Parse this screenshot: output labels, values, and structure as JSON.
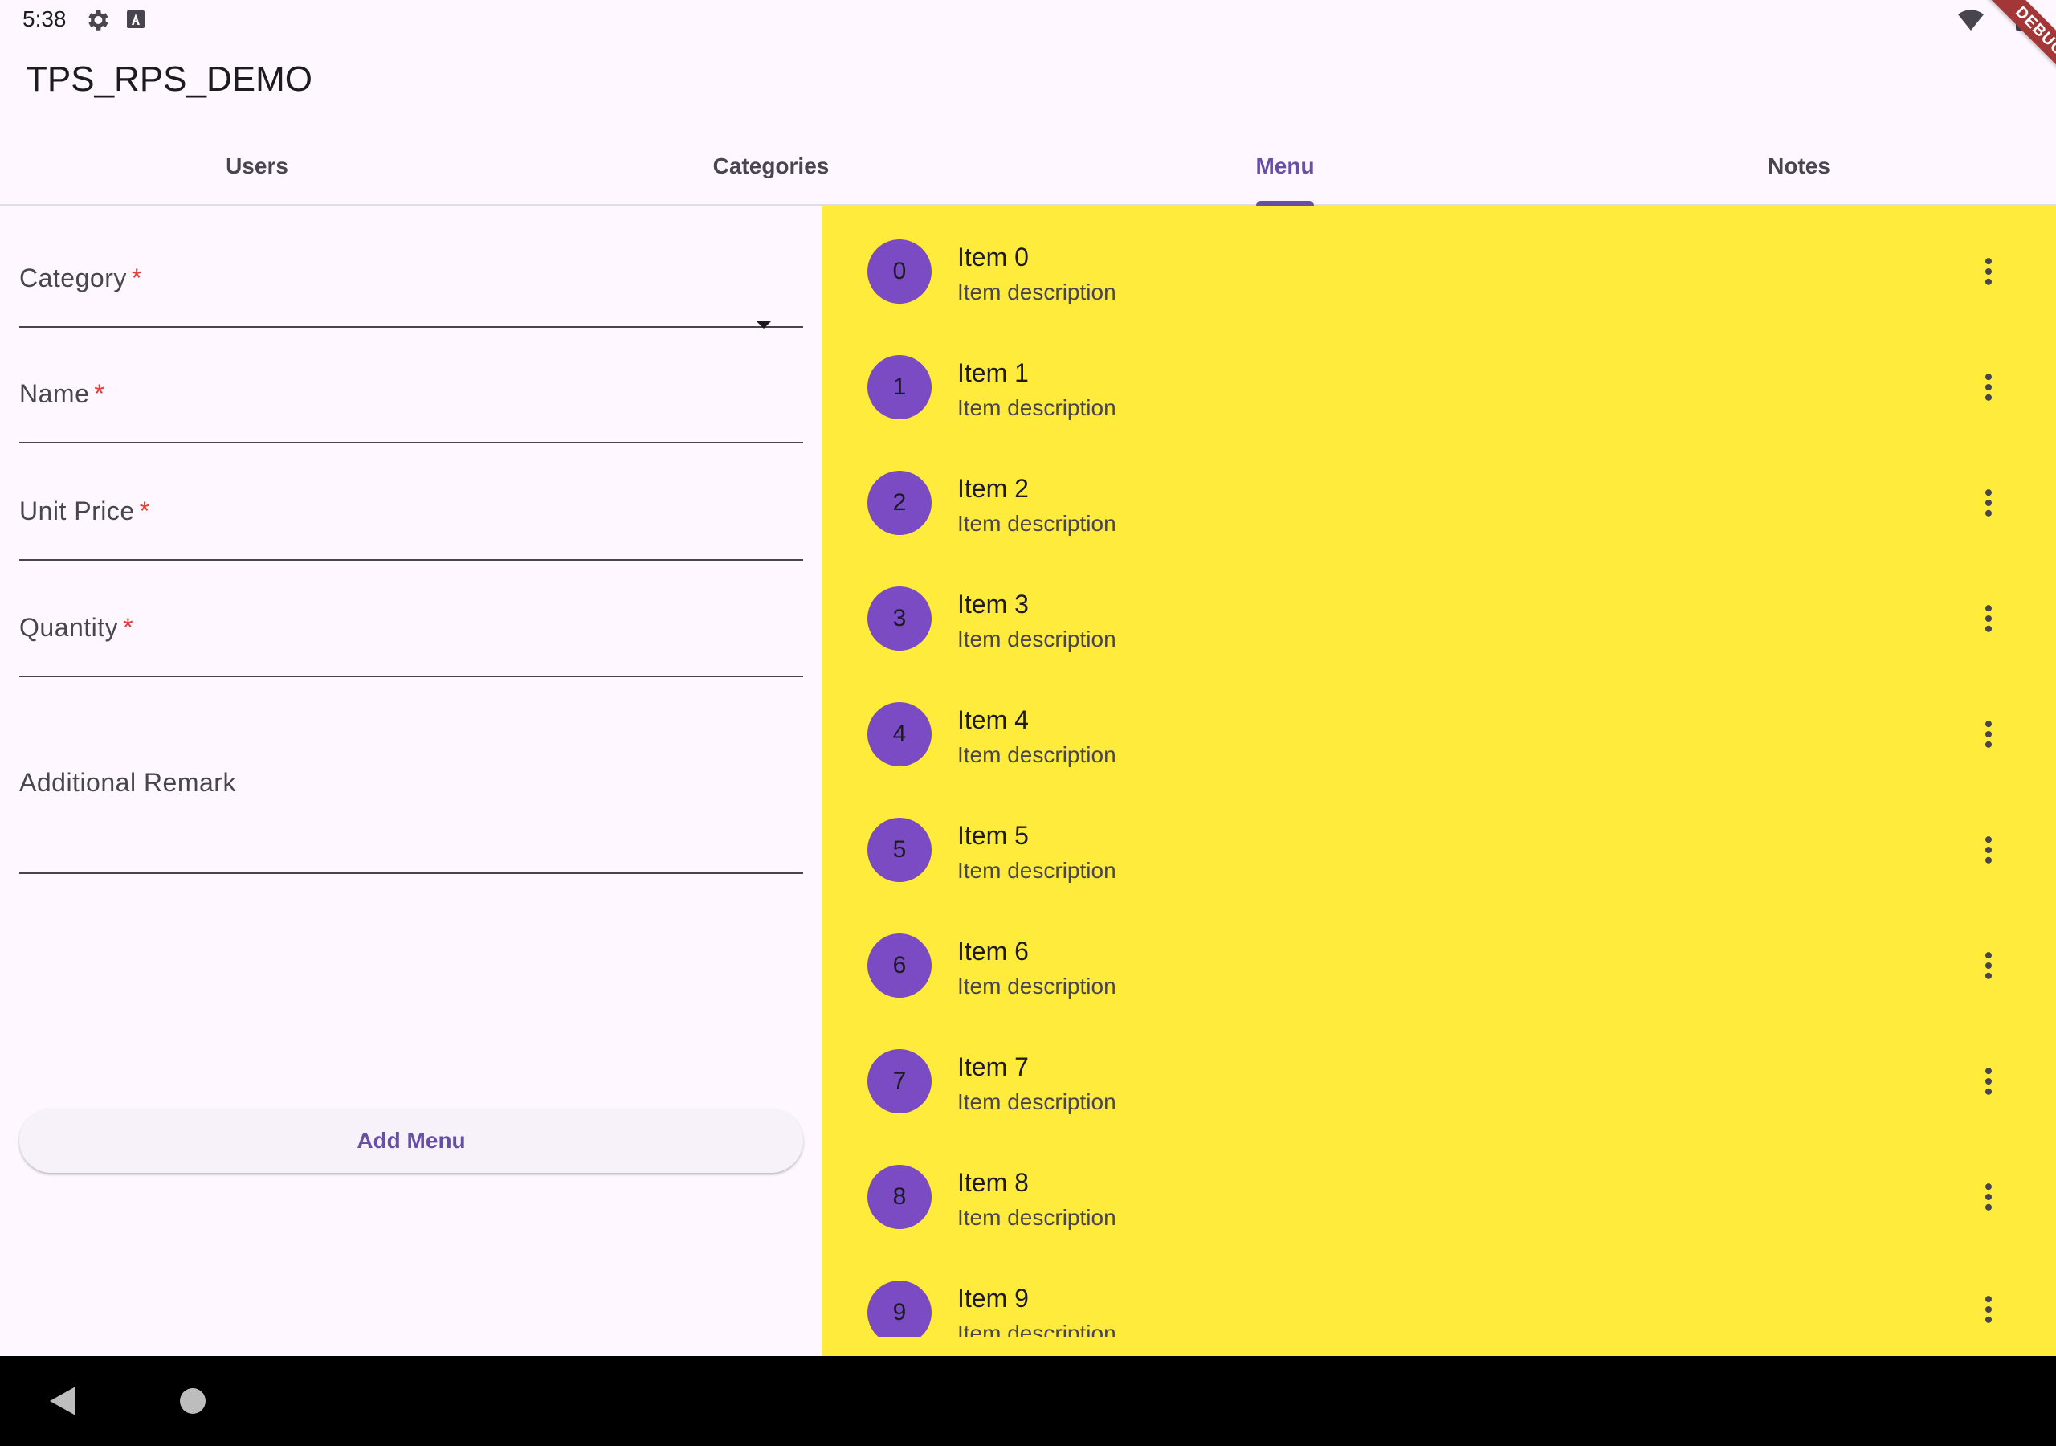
{
  "status_bar": {
    "time": "5:38",
    "icons": [
      "gear-icon",
      "a-icon",
      "wifi-icon",
      "battery-icon"
    ]
  },
  "debug_banner": "DEBUG",
  "app_bar": {
    "title": "TPS_RPS_DEMO"
  },
  "tabs": [
    {
      "label": "Users",
      "active": false
    },
    {
      "label": "Categories",
      "active": false
    },
    {
      "label": "Menu",
      "active": true
    },
    {
      "label": "Notes",
      "active": false
    }
  ],
  "form": {
    "category": {
      "label": "Category",
      "required_mark": "*",
      "value": ""
    },
    "name": {
      "label": "Name",
      "required_mark": "*",
      "value": ""
    },
    "unit_price": {
      "label": "Unit Price",
      "required_mark": "*",
      "value": ""
    },
    "quantity": {
      "label": "Quantity",
      "required_mark": "*",
      "value": ""
    },
    "remark": {
      "label": "Additional Remark",
      "value": ""
    },
    "submit_label": "Add Menu"
  },
  "menu_list": {
    "items": [
      {
        "index": "0",
        "title": "Item 0",
        "description": "Item description"
      },
      {
        "index": "1",
        "title": "Item 1",
        "description": "Item description"
      },
      {
        "index": "2",
        "title": "Item 2",
        "description": "Item description"
      },
      {
        "index": "3",
        "title": "Item 3",
        "description": "Item description"
      },
      {
        "index": "4",
        "title": "Item 4",
        "description": "Item description"
      },
      {
        "index": "5",
        "title": "Item 5",
        "description": "Item description"
      },
      {
        "index": "6",
        "title": "Item 6",
        "description": "Item description"
      },
      {
        "index": "7",
        "title": "Item 7",
        "description": "Item description"
      },
      {
        "index": "8",
        "title": "Item 8",
        "description": "Item description"
      },
      {
        "index": "9",
        "title": "Item 9",
        "description": "Item description"
      }
    ]
  },
  "colors": {
    "primary": "#6750a4",
    "avatar": "#7b4bc4",
    "list_background": "#ffeb3b",
    "required": "#e53935",
    "background": "#fef7ff"
  }
}
